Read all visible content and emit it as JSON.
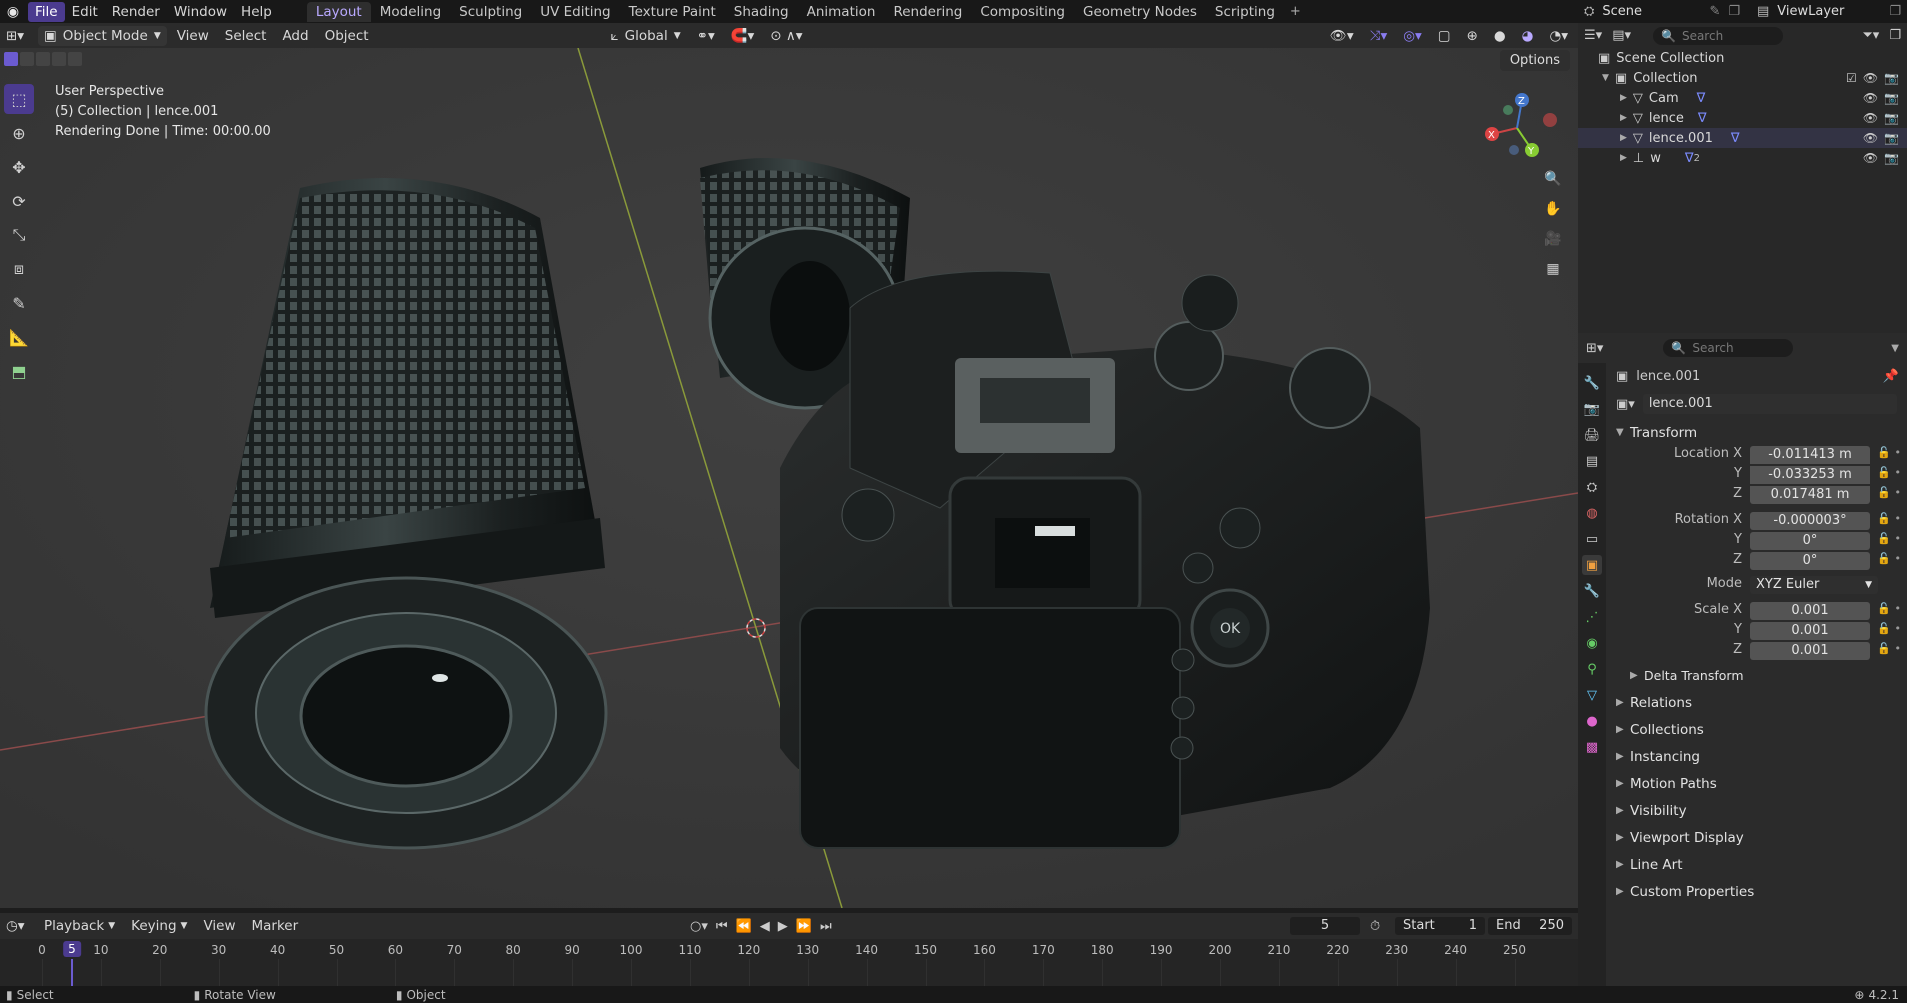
{
  "menus": [
    "File",
    "Edit",
    "Render",
    "Window",
    "Help"
  ],
  "workspaces": [
    "Layout",
    "Modeling",
    "Sculpting",
    "UV Editing",
    "Texture Paint",
    "Shading",
    "Animation",
    "Rendering",
    "Compositing",
    "Geometry Nodes",
    "Scripting"
  ],
  "scene": "Scene",
  "view_layer": "ViewLayer",
  "header": {
    "mode": "Object Mode",
    "view": "View",
    "select": "Select",
    "add": "Add",
    "object": "Object",
    "transform_orientation": "Global"
  },
  "viewport": {
    "line1": "User Perspective",
    "line2": "(5) Collection | lence.001",
    "line3": "Rendering Done | Time: 00:00.00",
    "options": "Options",
    "gizmo": {
      "x": "X",
      "y": "Y",
      "z": "Z"
    }
  },
  "outliner": {
    "search_placeholder": "Search",
    "root": "Scene Collection",
    "collection": "Collection",
    "items": [
      {
        "name": "Cam"
      },
      {
        "name": "lence"
      },
      {
        "name": "lence.001"
      },
      {
        "name": "w",
        "count": "2"
      }
    ]
  },
  "properties": {
    "search_placeholder": "Search",
    "object_name": "lence.001",
    "datablock_name": "lence.001",
    "transform_title": "Transform",
    "location_label": "Location X",
    "rotation_label": "Rotation X",
    "scale_label": "Scale X",
    "y_label": "Y",
    "z_label": "Z",
    "location": [
      "-0.011413 m",
      "-0.033253 m",
      "0.017481 m"
    ],
    "rotation": [
      "-0.000003°",
      "0°",
      "0°"
    ],
    "mode_label": "Mode",
    "mode_value": "XYZ Euler",
    "scale": [
      "0.001",
      "0.001",
      "0.001"
    ],
    "delta": "Delta Transform",
    "panels": [
      "Relations",
      "Collections",
      "Instancing",
      "Motion Paths",
      "Visibility",
      "Viewport Display",
      "Line Art",
      "Custom Properties"
    ]
  },
  "timeline": {
    "playback": "Playback",
    "keying": "Keying",
    "view": "View",
    "marker": "Marker",
    "current_frame": "5",
    "start_label": "Start",
    "start": "1",
    "end_label": "End",
    "end": "250",
    "ruler": [
      "0",
      "10",
      "20",
      "30",
      "40",
      "50",
      "60",
      "70",
      "80",
      "90",
      "100",
      "110",
      "120",
      "130",
      "140",
      "150",
      "160",
      "170",
      "180",
      "190",
      "200",
      "210",
      "220",
      "230",
      "240",
      "250"
    ]
  },
  "status": {
    "select": "Select",
    "rotate": "Rotate View",
    "object": "Object",
    "version": "4.2.1"
  },
  "colors": {
    "accent": "#4b3b8f",
    "active_text": "#b9a9ff"
  }
}
